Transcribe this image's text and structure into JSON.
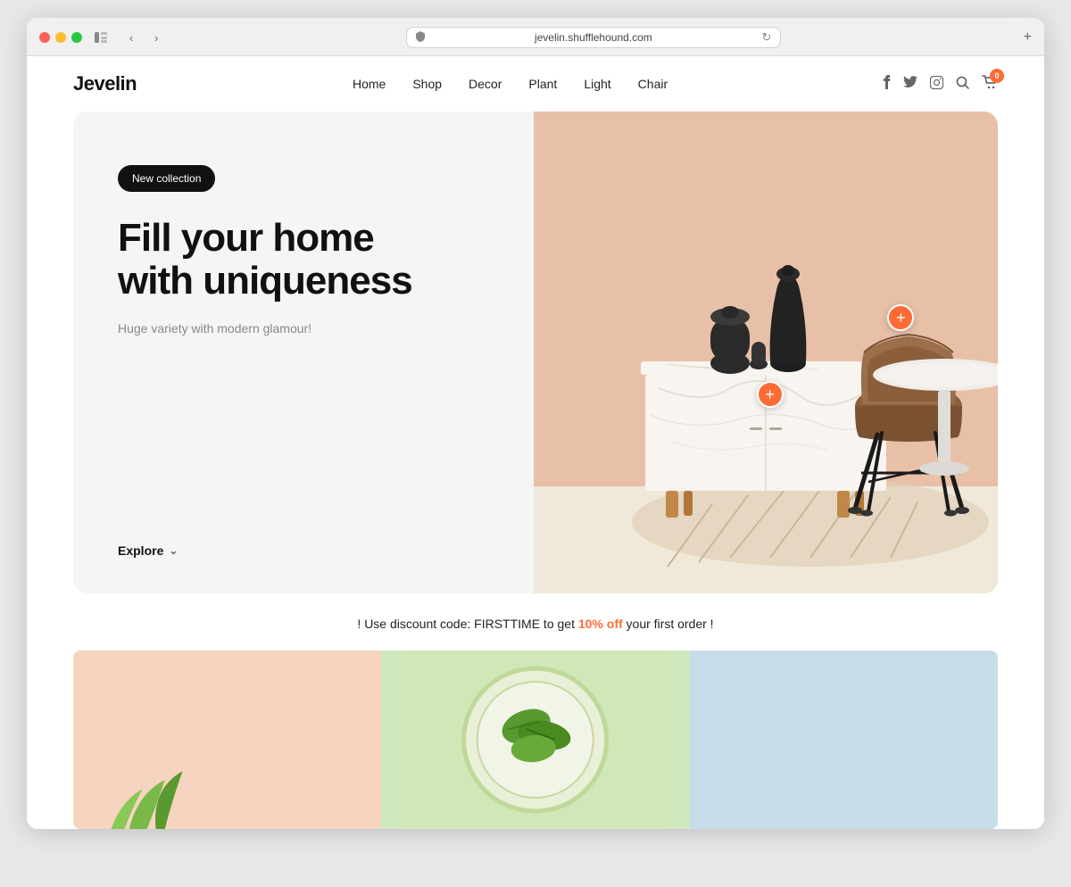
{
  "browser": {
    "url": "jevelin.shufflehound.com",
    "new_tab_label": "+"
  },
  "header": {
    "logo": "Jevelin",
    "nav": {
      "items": [
        {
          "label": "Home",
          "id": "home"
        },
        {
          "label": "Shop",
          "id": "shop"
        },
        {
          "label": "Decor",
          "id": "decor"
        },
        {
          "label": "Plant",
          "id": "plant"
        },
        {
          "label": "Light",
          "id": "light"
        },
        {
          "label": "Chair",
          "id": "chair"
        }
      ]
    },
    "cart_badge": "0"
  },
  "hero": {
    "badge": "New collection",
    "title": "Fill your home\nwith uniqueness",
    "subtitle": "Huge variety with modern glamour!",
    "explore_label": "Explore"
  },
  "discount": {
    "text_before": "! Use discount code: FIRSTTIME to get ",
    "highlight": "10% off",
    "text_after": " your first order !"
  },
  "categories": [
    {
      "id": "peach",
      "color": "#f5d5c0"
    },
    {
      "id": "green",
      "color": "#d4e8c0"
    },
    {
      "id": "blue",
      "color": "#c8dce8"
    }
  ]
}
